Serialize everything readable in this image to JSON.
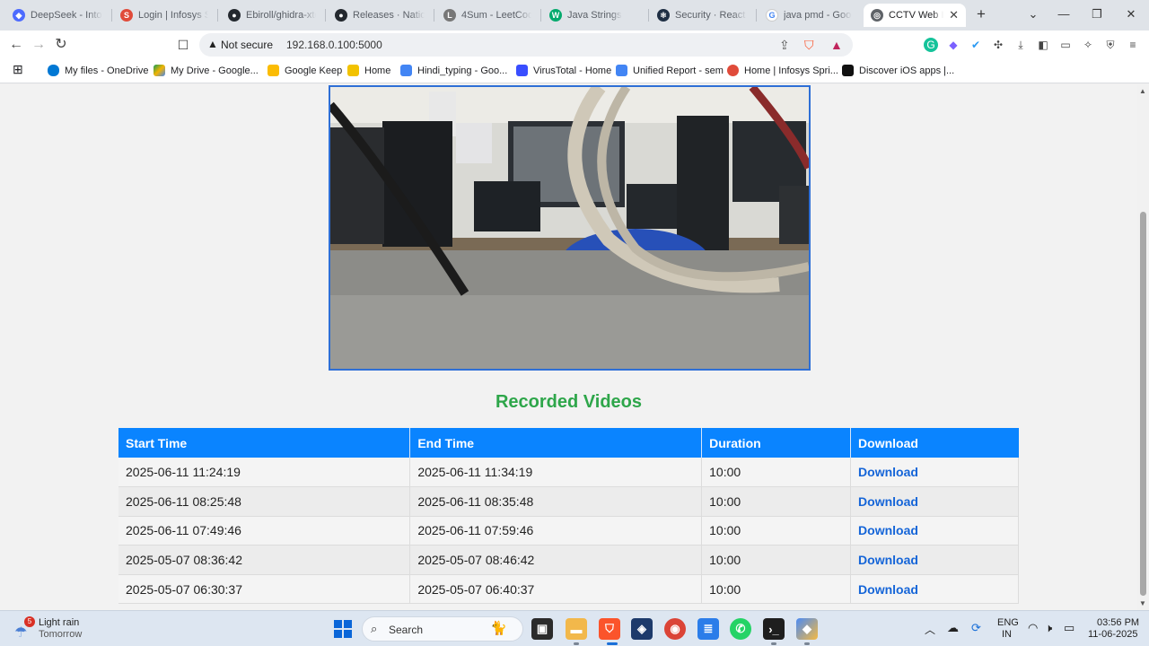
{
  "browser": {
    "tabs": [
      {
        "label": "DeepSeek - Into t",
        "icon": "deepseek-icon",
        "color": "#4d6bfe"
      },
      {
        "label": "Login | Infosys Sp",
        "icon": "infosys-icon",
        "color": "#e04b3a"
      },
      {
        "label": "Ebiroll/ghidra-xte",
        "icon": "github-icon",
        "color": "#24292f"
      },
      {
        "label": "Releases · Nationa",
        "icon": "github-icon",
        "color": "#24292f"
      },
      {
        "label": "4Sum - LeetCode",
        "icon": "leetcode-icon",
        "color": "#555555"
      },
      {
        "label": "Java Strings",
        "icon": "w3schools-icon",
        "color": "#04aa6d"
      },
      {
        "label": "Security · React N",
        "icon": "react-native-icon",
        "color": "#1f2f44"
      },
      {
        "label": "java pmd - Googl",
        "icon": "google-icon",
        "color": "#4285f4"
      },
      {
        "label": "CCTV Web In",
        "icon": "globe-icon",
        "color": "#5f6368",
        "active": true
      }
    ],
    "new_tab": "+",
    "window_controls": {
      "tab_search": "⌄",
      "minimize": "—",
      "restore": "❐",
      "close": "✕"
    },
    "address": {
      "security_label": "Not secure",
      "url": "192.168.0.100:5000"
    },
    "bookmarks": [
      {
        "label": "My files - OneDrive",
        "icon": "onedrive-icon",
        "color": "#0078d4"
      },
      {
        "label": "My Drive - Google...",
        "icon": "google-drive-icon",
        "color": "#f4b400"
      },
      {
        "label": "Google Keep",
        "icon": "keep-icon",
        "color": "#fbbc04"
      },
      {
        "label": "Home",
        "icon": "home-icon",
        "color": "#f2c200"
      },
      {
        "label": "Hindi_typing - Goo...",
        "icon": "docs-icon",
        "color": "#4285f4"
      },
      {
        "label": "VirusTotal - Home",
        "icon": "virustotal-icon",
        "color": "#394eff"
      },
      {
        "label": "Unified Report - sem",
        "icon": "docs-icon",
        "color": "#4285f4"
      },
      {
        "label": "Home | Infosys Spri...",
        "icon": "infosys-icon",
        "color": "#e04b3a"
      },
      {
        "label": "Discover iOS apps |...",
        "icon": "ios-apps-icon",
        "color": "#111111"
      }
    ]
  },
  "page": {
    "section_title": "Recorded Videos",
    "table": {
      "headers": [
        "Start Time",
        "End Time",
        "Duration",
        "Download"
      ],
      "rows": [
        {
          "start": "2025-06-11 11:24:19",
          "end": "2025-06-11 11:34:19",
          "duration": "10:00",
          "action": "Download"
        },
        {
          "start": "2025-06-11 08:25:48",
          "end": "2025-06-11 08:35:48",
          "duration": "10:00",
          "action": "Download"
        },
        {
          "start": "2025-06-11 07:49:46",
          "end": "2025-06-11 07:59:46",
          "duration": "10:00",
          "action": "Download"
        },
        {
          "start": "2025-05-07 08:36:42",
          "end": "2025-05-07 08:46:42",
          "duration": "10:00",
          "action": "Download"
        },
        {
          "start": "2025-05-07 06:30:37",
          "end": "2025-05-07 06:40:37",
          "duration": "10:00",
          "action": "Download"
        }
      ]
    }
  },
  "taskbar": {
    "weather": {
      "badge": "5",
      "title": "Light rain",
      "subtitle": "Tomorrow"
    },
    "search_label": "Search",
    "language": {
      "line1": "ENG",
      "line2": "IN"
    },
    "clock": {
      "time": "03:56 PM",
      "date": "11-06-2025"
    }
  },
  "colors": {
    "accent": "#0a84ff",
    "title_green": "#2ea64a",
    "link_blue": "#1565d8"
  }
}
